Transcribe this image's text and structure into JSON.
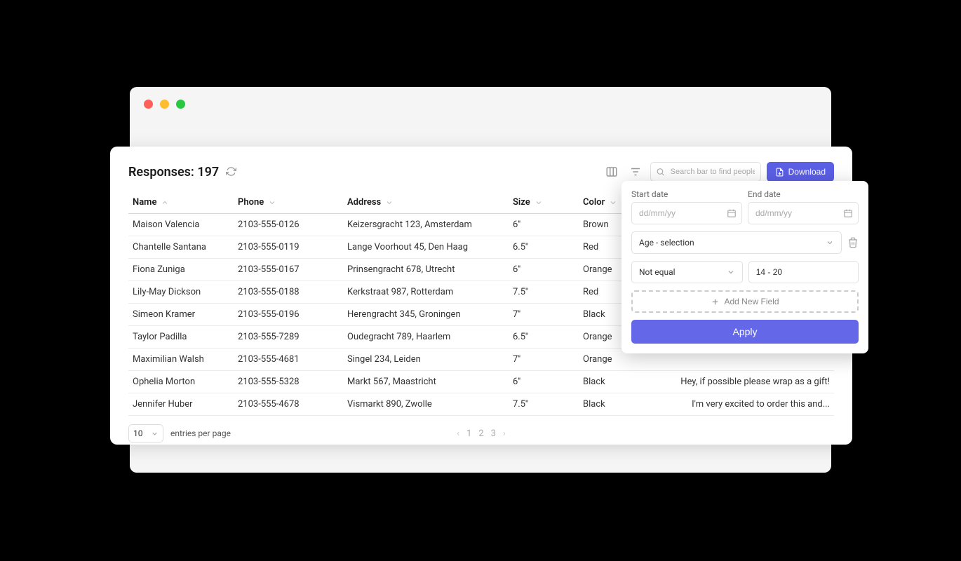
{
  "header": {
    "title_prefix": "Responses:",
    "count": "197",
    "search_placeholder": "Search bar to find people",
    "download_label": "Download"
  },
  "columns": {
    "name": "Name",
    "phone": "Phone",
    "address": "Address",
    "size": "Size",
    "color": "Color"
  },
  "rows": [
    {
      "name": "Maison Valencia",
      "phone": "2103-555-0126",
      "address": "Keizersgracht 123, Amsterdam",
      "size": "6''",
      "color": "Brown",
      "notes": ""
    },
    {
      "name": "Chantelle Santana",
      "phone": "2103-555-0119",
      "address": "Lange Voorhout 45, Den Haag",
      "size": "6.5''",
      "color": "Red",
      "notes": ""
    },
    {
      "name": "Fiona Zuniga",
      "phone": "2103-555-0167",
      "address": "Prinsengracht 678, Utrecht",
      "size": "6''",
      "color": "Orange",
      "notes": ""
    },
    {
      "name": "Lily-May Dickson",
      "phone": "2103-555-0188",
      "address": "Kerkstraat 987, Rotterdam",
      "size": "7.5''",
      "color": "Red",
      "notes": ""
    },
    {
      "name": "Simeon Kramer",
      "phone": "2103-555-0196",
      "address": "Herengracht 345, Groningen",
      "size": "7''",
      "color": "Black",
      "notes": ""
    },
    {
      "name": "Taylor Padilla",
      "phone": "2103-555-7289",
      "address": "Oudegracht 789, Haarlem",
      "size": "6.5''",
      "color": "Orange",
      "notes": ""
    },
    {
      "name": "Maximilian Walsh",
      "phone": "2103-555-4681",
      "address": "Singel 234, Leiden",
      "size": "7''",
      "color": "Orange",
      "notes": ""
    },
    {
      "name": "Ophelia Morton",
      "phone": "2103-555-5328",
      "address": "Markt 567, Maastricht",
      "size": "6''",
      "color": "Black",
      "notes": "Hey, if possible please wrap as a gift!"
    },
    {
      "name": "Jennifer Huber",
      "phone": "2103-555-4678",
      "address": "Vismarkt 890, Zwolle",
      "size": "7.5''",
      "color": "Black",
      "notes": "I'm very excited to order this and..."
    }
  ],
  "footer": {
    "entries_value": "10",
    "entries_label": "entries per page",
    "pages": [
      "1",
      "2",
      "3"
    ]
  },
  "filter": {
    "start_label": "Start date",
    "end_label": "End date",
    "date_placeholder": "dd/mm/yy",
    "field_select": "Age - selection",
    "operator": "Not equal",
    "value": "14 - 20",
    "add_field_label": "Add New Field",
    "apply_label": "Apply"
  }
}
